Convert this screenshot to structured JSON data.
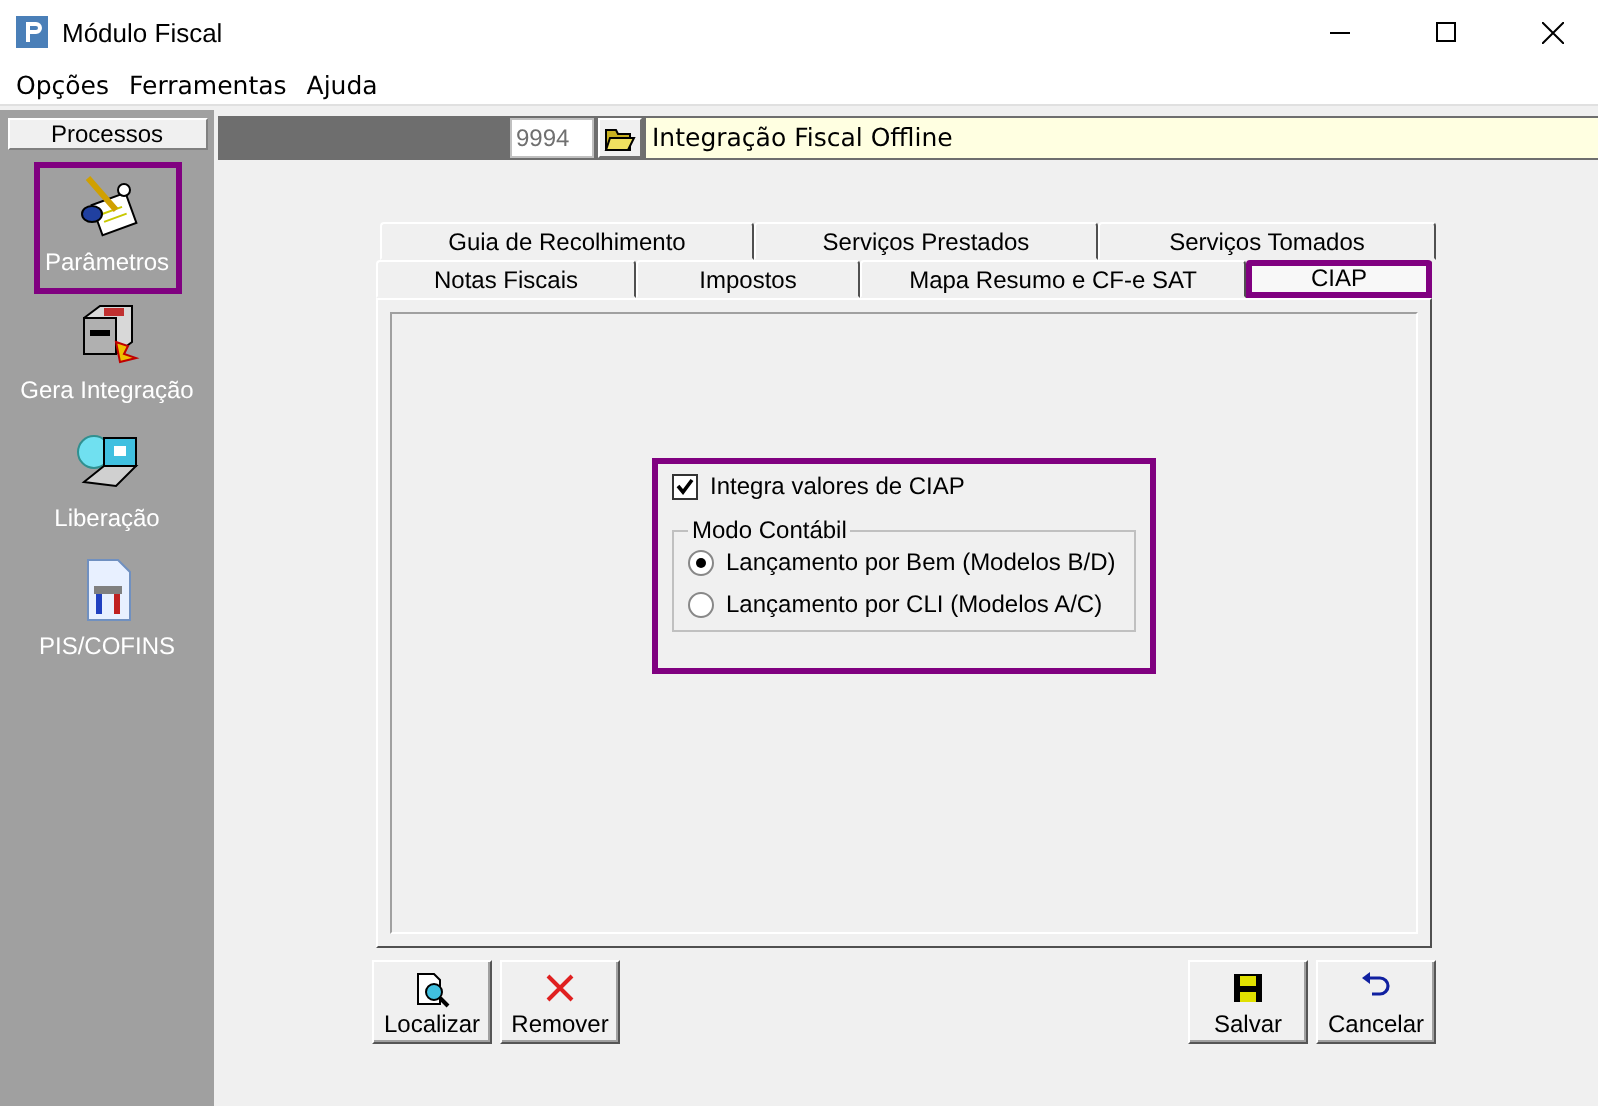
{
  "window": {
    "title": "Módulo Fiscal"
  },
  "menu": [
    "Opções",
    "Ferramentas",
    "Ajuda"
  ],
  "sidebar": {
    "header": "Processos",
    "items": [
      {
        "label": "Parâmetros",
        "highlighted": true
      },
      {
        "label": "Gera Integração",
        "highlighted": false
      },
      {
        "label": "Liberação",
        "highlighted": false
      },
      {
        "label": "PIS/COFINS",
        "highlighted": false
      }
    ]
  },
  "record": {
    "code": "9994",
    "title": "Integração Fiscal Offline"
  },
  "tab_rows": [
    [
      {
        "label": "Guia de Recolhimento",
        "selected": false,
        "highlighted": false
      },
      {
        "label": "Serviços Prestados",
        "selected": false,
        "highlighted": false
      },
      {
        "label": "Serviços Tomados",
        "selected": false,
        "highlighted": false
      }
    ],
    [
      {
        "label": "Notas Fiscais",
        "selected": false,
        "highlighted": false
      },
      {
        "label": "Impostos",
        "selected": false,
        "highlighted": false
      },
      {
        "label": "Mapa Resumo e CF-e SAT",
        "selected": false,
        "highlighted": false
      },
      {
        "label": "CIAP",
        "selected": true,
        "highlighted": true
      }
    ]
  ],
  "panel": {
    "highlighted": true,
    "checkbox": {
      "label": "Integra valores de CIAP",
      "checked": true
    },
    "group": {
      "title": "Modo Contábil",
      "options": [
        {
          "label": "Lançamento por Bem (Modelos B/D)",
          "selected": true
        },
        {
          "label": "Lançamento por CLI (Modelos A/C)",
          "selected": false
        }
      ]
    }
  },
  "buttons_left": [
    {
      "label": "Localizar"
    },
    {
      "label": "Remover"
    }
  ],
  "buttons_right": [
    {
      "label": "Salvar"
    },
    {
      "label": "Cancelar"
    }
  ]
}
